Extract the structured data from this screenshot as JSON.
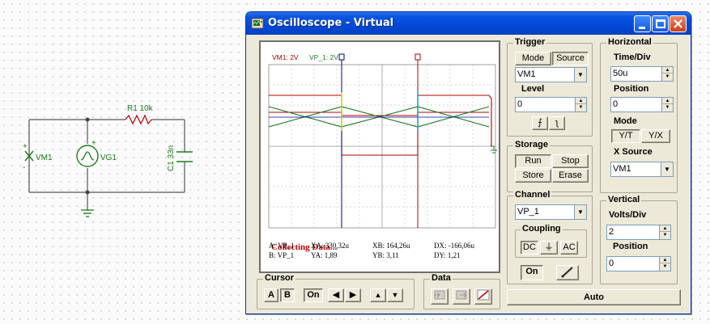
{
  "schematic": {
    "resistor_label": "R1 10k",
    "capacitor_label": "C1 33n",
    "source_label": "VG1",
    "probe_label": "VM1",
    "plus_sign": "+",
    "minus_sign": "-"
  },
  "window": {
    "title": "Oscilloscope - Virtual"
  },
  "screen": {
    "legend_vm1": "VM1: 2V",
    "legend_vp1": "VP_1: 2V",
    "status": "Collecting Data...",
    "readout": {
      "a_label": "A:  VP_1",
      "xa": "XA:  330,32u",
      "xb": "XB:  164,26u",
      "dx": "DX:  -166,06u",
      "b_label": "B:  VP_1",
      "ya": "YA:  1,89",
      "yb": "YB:  3,11",
      "dy": "DY:  1,21"
    },
    "trace_colors": {
      "vm1": "#b00000",
      "vp1": "#1a7a1a",
      "cursor_a": "#00008b",
      "cursor_b": "#b00000"
    }
  },
  "cursor": {
    "title": "Cursor",
    "a": "A",
    "b": "B",
    "on": "On"
  },
  "data": {
    "title": "Data"
  },
  "trigger": {
    "title": "Trigger",
    "mode": "Mode",
    "source": "Source",
    "channel": "VM1",
    "level_label": "Level",
    "level": "0"
  },
  "storage": {
    "title": "Storage",
    "run": "Run",
    "stop": "Stop",
    "store": "Store",
    "erase": "Erase"
  },
  "horizontal": {
    "title": "Horizontal",
    "time_label": "Time/Div",
    "time": "50u",
    "position_label": "Position",
    "position": "0",
    "mode_label": "Mode",
    "yt": "Y/T",
    "yx": "Y/X",
    "xsource_label": "X Source",
    "xsource": "VM1"
  },
  "channel": {
    "title": "Channel",
    "name": "VP_1",
    "coupling_label": "Coupling",
    "dc": "DC",
    "ac": "AC",
    "on": "On"
  },
  "vertical": {
    "title": "Vertical",
    "volts_label": "Volts/Div",
    "volts": "2",
    "position_label": "Position",
    "position": "0"
  },
  "auto_button": "Auto"
}
